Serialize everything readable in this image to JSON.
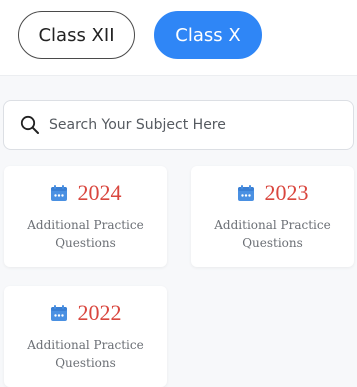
{
  "tabs": {
    "class_xii_label": "Class XII",
    "class_x_label": "Class X",
    "active": "Class X"
  },
  "search": {
    "placeholder": "Search Your Subject Here",
    "value": ""
  },
  "cards": [
    {
      "year": "2024",
      "line1": "Additional Practice",
      "line2": "Questions",
      "icon": "calendar-icon"
    },
    {
      "year": "2023",
      "line1": "Additional Practice",
      "line2": "Questions",
      "icon": "calendar-icon"
    },
    {
      "year": "2022",
      "line1": "Additional Practice",
      "line2": "Questions",
      "icon": "calendar-icon"
    }
  ],
  "colors": {
    "accent": "#2f86f6",
    "year": "#d9463e",
    "calendar": "#4a90e2"
  }
}
